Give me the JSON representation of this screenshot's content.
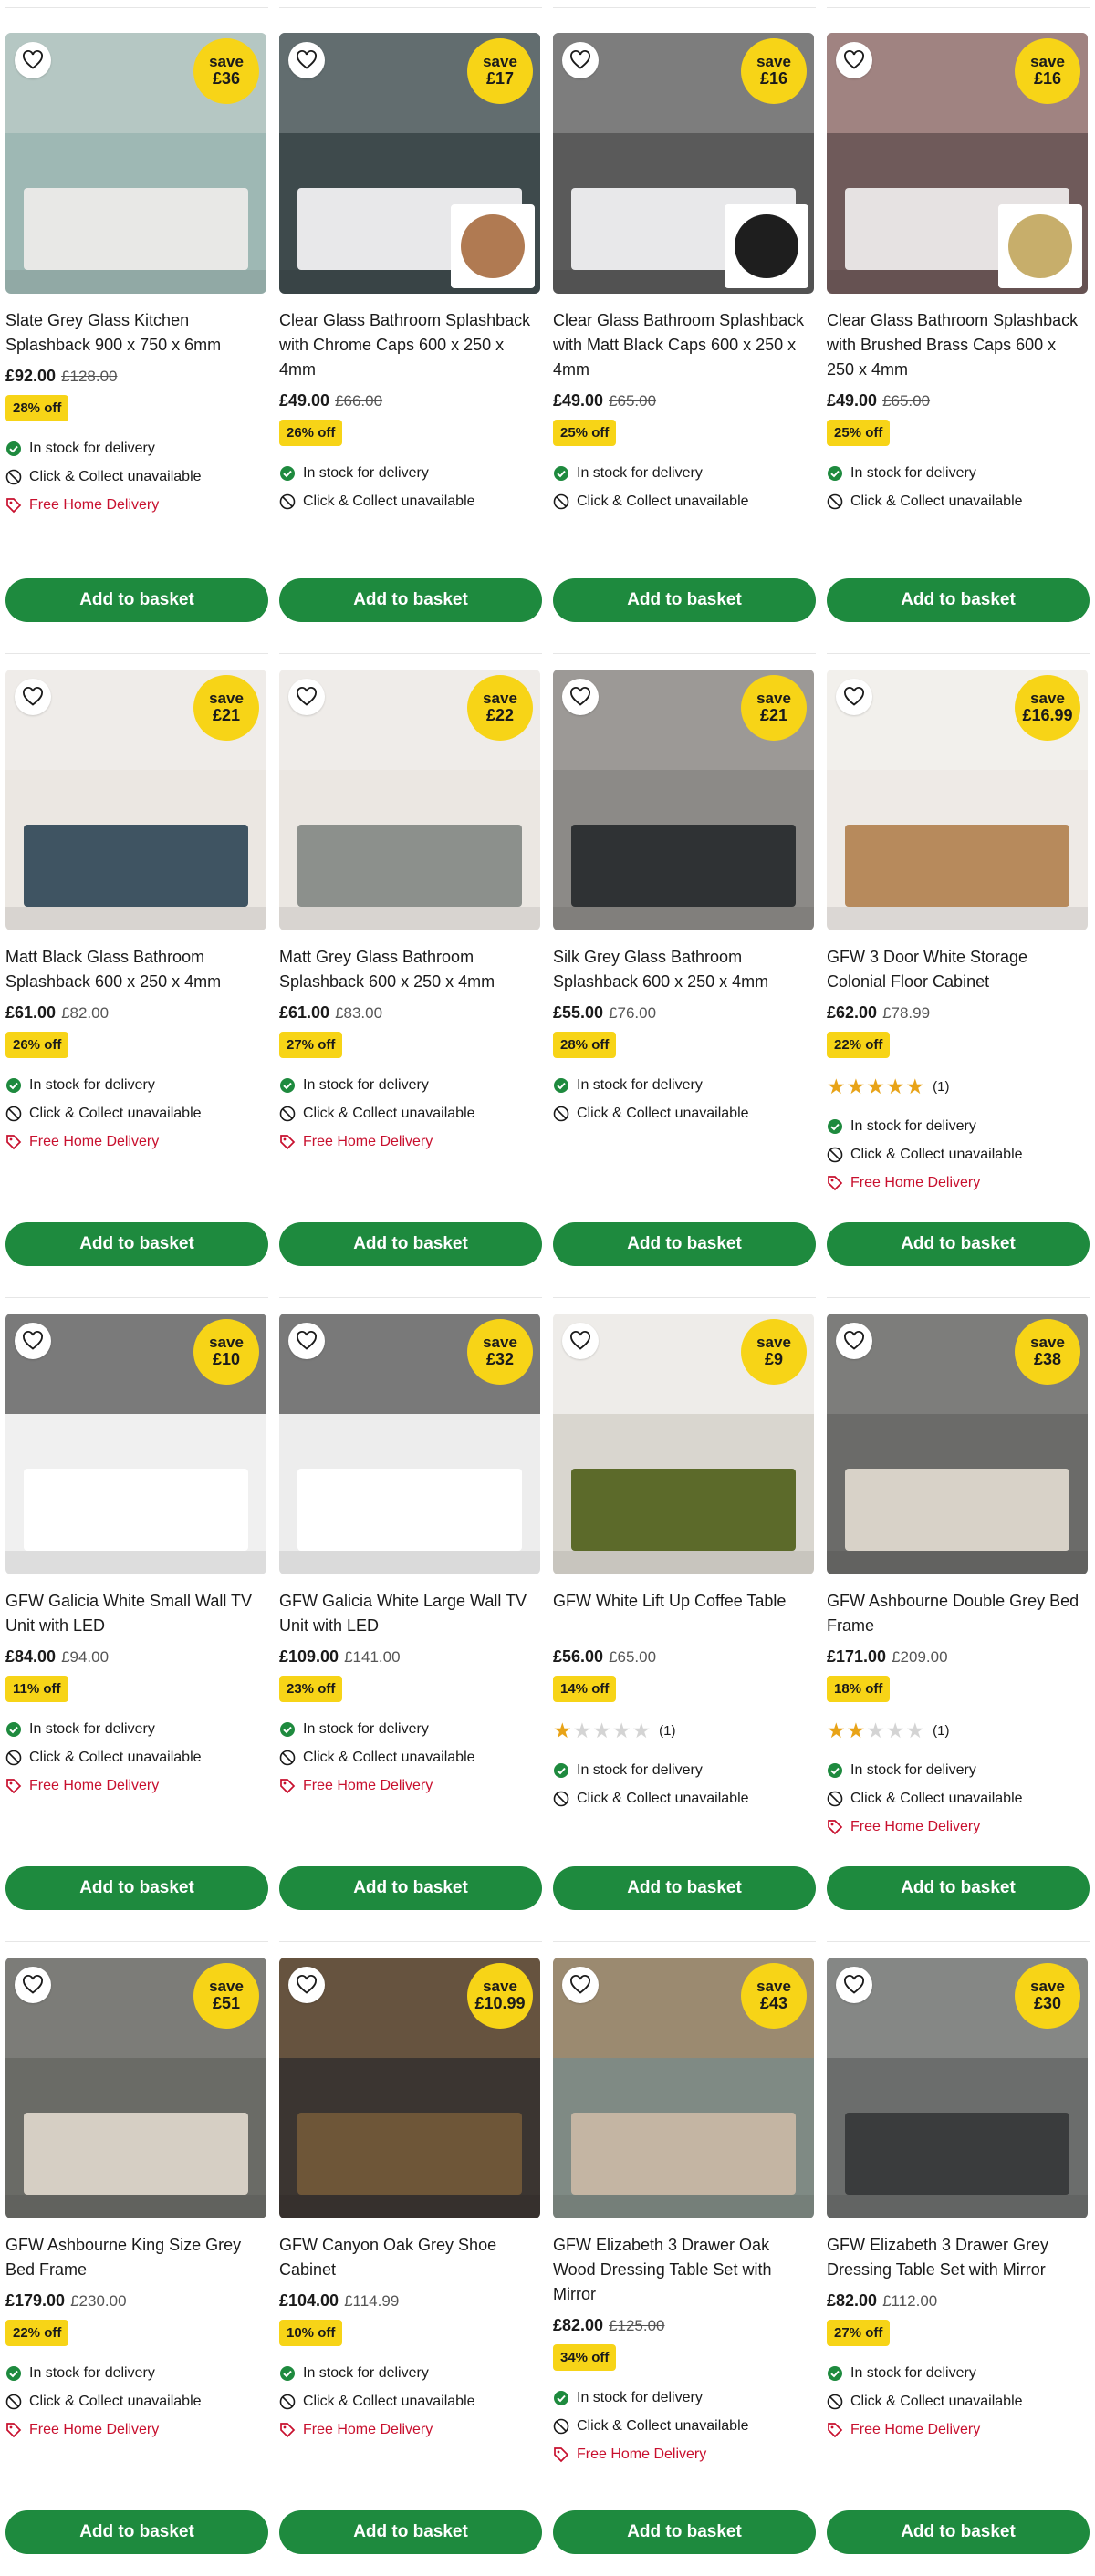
{
  "labels": {
    "save": "save",
    "add_to_basket": "Add to basket",
    "in_stock": "In stock for delivery",
    "click_collect": "Click & Collect unavailable",
    "free_delivery": "Free Home Delivery"
  },
  "colors": {
    "accent_green": "#1e8a3e",
    "badge_yellow": "#f7d417",
    "free_delivery_red": "#c8102e",
    "star": "#e8a317"
  },
  "products": [
    {
      "title": "Slate Grey Glass Kitchen Splashback 900 x 750 x 6mm",
      "price": "£92.00",
      "was": "£128.00",
      "off": "28% off",
      "save": "£36",
      "free_delivery": true,
      "rating": null,
      "image": {
        "bg": "#9eb8b4",
        "top": "#c9d3d0",
        "base": "#e8e8e6",
        "swatch": null
      }
    },
    {
      "title": "Clear Glass Bathroom Splashback with Chrome Caps 600 x 250 x 4mm",
      "price": "£49.00",
      "was": "£66.00",
      "off": "26% off",
      "save": "£17",
      "free_delivery": false,
      "rating": null,
      "image": {
        "bg": "#3e4a4c",
        "top": "#7f8b8c",
        "base": "#e8e8ea",
        "swatch": "#b07a52"
      }
    },
    {
      "title": "Clear Glass Bathroom Splashback with Matt Black Caps 600 x 250 x 4mm",
      "price": "£49.00",
      "was": "£65.00",
      "off": "25% off",
      "save": "£16",
      "free_delivery": false,
      "rating": null,
      "image": {
        "bg": "#5a5a5a",
        "top": "#9a9a9a",
        "base": "#e8e8ea",
        "swatch": "#1e1e1e"
      }
    },
    {
      "title": "Clear Glass Bathroom Splashback with Brushed Brass Caps 600 x 250 x 4mm",
      "price": "£49.00",
      "was": "£65.00",
      "off": "25% off",
      "save": "£16",
      "free_delivery": false,
      "rating": null,
      "image": {
        "bg": "#6f5a5a",
        "top": "#c9a6a3",
        "base": "#e6e2e2",
        "swatch": "#c7ae6b"
      }
    },
    {
      "title": "Matt Black Glass Bathroom Splashback 600 x 250 x 4mm",
      "price": "£61.00",
      "was": "£82.00",
      "off": "26% off",
      "save": "£21",
      "free_delivery": true,
      "rating": null,
      "image": {
        "bg": "#ebe7e2",
        "top": "#f3f1ee",
        "base": "#3f5462",
        "swatch": null
      }
    },
    {
      "title": "Matt Grey Glass Bathroom Splashback 600 x 250 x 4mm",
      "price": "£61.00",
      "was": "£83.00",
      "off": "27% off",
      "save": "£22",
      "free_delivery": true,
      "rating": null,
      "image": {
        "bg": "#ebe7e2",
        "top": "#f3f1ee",
        "base": "#8c908c",
        "swatch": null
      }
    },
    {
      "title": "Silk Grey Glass Bathroom Splashback 600 x 250 x 4mm",
      "price": "£55.00",
      "was": "£76.00",
      "off": "28% off",
      "save": "£21",
      "free_delivery": false,
      "rating": null,
      "image": {
        "bg": "#8c8a87",
        "top": "#a9a6a2",
        "base": "#2f3234",
        "swatch": null
      }
    },
    {
      "title": "GFW 3 Door White Storage Colonial Floor Cabinet",
      "price": "£62.00",
      "was": "£78.99",
      "off": "22% off",
      "save": "£16.99",
      "free_delivery": true,
      "rating": {
        "stars": 5,
        "count": "(1)"
      },
      "image": {
        "bg": "#eeeae6",
        "top": "#f6f4f1",
        "base": "#b78a5c",
        "swatch": null
      }
    },
    {
      "title": "GFW Galicia White Small Wall TV Unit with LED",
      "price": "£84.00",
      "was": "£94.00",
      "off": "11% off",
      "save": "£10",
      "free_delivery": true,
      "rating": null,
      "image": {
        "bg": "#f0f0f0",
        "top": "#1a1a1a",
        "base": "#ffffff",
        "swatch": null
      }
    },
    {
      "title": "GFW Galicia White Large Wall TV Unit with LED",
      "price": "£109.00",
      "was": "£141.00",
      "off": "23% off",
      "save": "£32",
      "free_delivery": true,
      "rating": null,
      "image": {
        "bg": "#ededed",
        "top": "#1a1a1a",
        "base": "#ffffff",
        "swatch": null
      }
    },
    {
      "title": "GFW White Lift Up Coffee Table",
      "price": "£56.00",
      "was": "£65.00",
      "off": "14% off",
      "save": "£9",
      "free_delivery": false,
      "rating": {
        "stars": 1,
        "count": "(1)"
      },
      "image": {
        "bg": "#d9d6cf",
        "top": "#ffffff",
        "base": "#5c6a2a",
        "swatch": null
      }
    },
    {
      "title": "GFW Ashbourne Double Grey Bed Frame",
      "price": "£171.00",
      "was": "£209.00",
      "off": "18% off",
      "save": "£38",
      "free_delivery": true,
      "rating": {
        "stars": 2,
        "count": "(1)"
      },
      "image": {
        "bg": "#6b6b69",
        "top": "#8d8d8b",
        "base": "#d8d2c8",
        "swatch": null
      }
    },
    {
      "title": "GFW Ashbourne King Size Grey Bed Frame",
      "price": "£179.00",
      "was": "£230.00",
      "off": "22% off",
      "save": "£51",
      "free_delivery": true,
      "rating": null,
      "image": {
        "bg": "#6a6b66",
        "top": "#8a8b86",
        "base": "#d6cfc4",
        "swatch": null
      }
    },
    {
      "title": "GFW Canyon Oak Grey Shoe Cabinet",
      "price": "£104.00",
      "was": "£114.99",
      "off": "10% off",
      "save": "£10.99",
      "free_delivery": true,
      "rating": null,
      "image": {
        "bg": "#3b3531",
        "top": "#8a6c4a",
        "base": "#6e5638",
        "swatch": null
      }
    },
    {
      "title": "GFW Elizabeth 3 Drawer Oak Wood Dressing Table Set with Mirror",
      "price": "£82.00",
      "was": "£125.00",
      "off": "34% off",
      "save": "£43",
      "free_delivery": true,
      "rating": null,
      "image": {
        "bg": "#7f8a84",
        "top": "#b38b61",
        "base": "#c4b5a3",
        "swatch": null
      }
    },
    {
      "title": "GFW Elizabeth 3 Drawer Grey Dressing Table Set with Mirror",
      "price": "£82.00",
      "was": "£112.00",
      "off": "27% off",
      "save": "£30",
      "free_delivery": true,
      "rating": null,
      "image": {
        "bg": "#6b6d6c",
        "top": "#9a9c9b",
        "base": "#3a3c3d",
        "swatch": null
      }
    }
  ]
}
